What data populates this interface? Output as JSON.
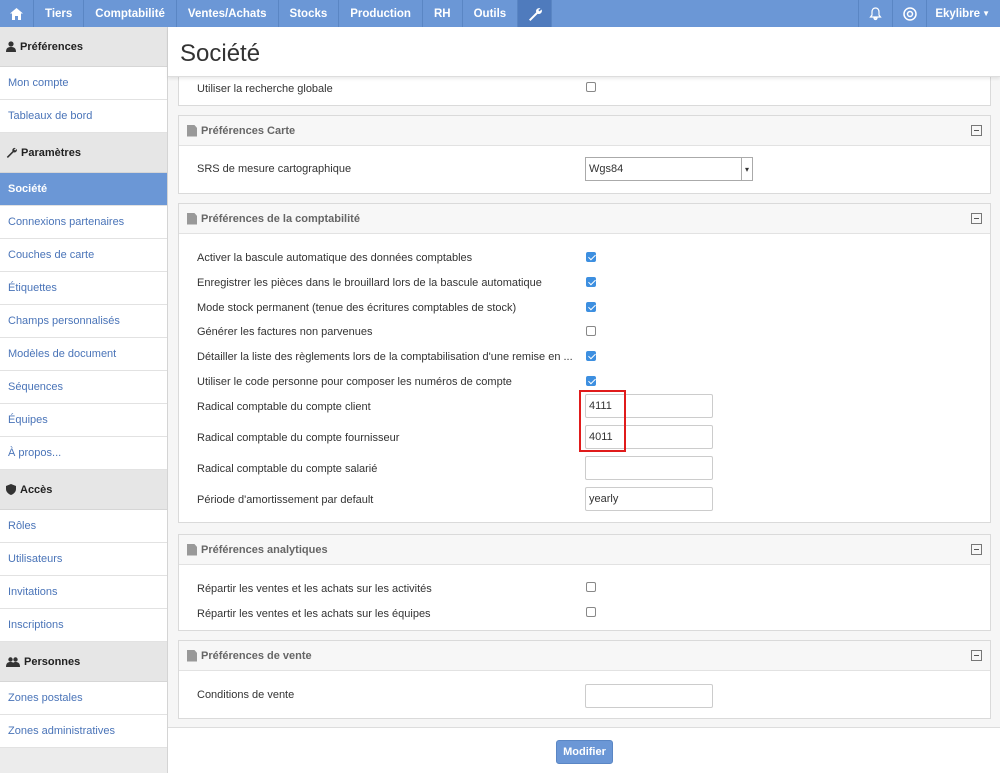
{
  "topnav": {
    "items": [
      "Tiers",
      "Comptabilité",
      "Ventes/Achats",
      "Stocks",
      "Production",
      "RH",
      "Outils"
    ],
    "user_label": "Ekylibre",
    "icons": [
      "home-icon",
      "wrench-icon",
      "bell-icon",
      "lifebuoy-icon"
    ]
  },
  "sidebar": {
    "sections": [
      {
        "title": "Préférences",
        "icon": "user-icon",
        "items": [
          "Mon compte",
          "Tableaux de bord"
        ]
      },
      {
        "title": "Paramètres",
        "icon": "wrench-icon",
        "items": [
          "Société",
          "Connexions partenaires",
          "Couches de carte",
          "Étiquettes",
          "Champs personnalisés",
          "Modèles de document",
          "Séquences",
          "Équipes",
          "À propos..."
        ]
      },
      {
        "title": "Accès",
        "icon": "shield-icon",
        "items": [
          "Rôles",
          "Utilisateurs",
          "Invitations",
          "Inscriptions"
        ]
      },
      {
        "title": "Personnes",
        "icon": "people-icon",
        "items": [
          "Zones postales",
          "Zones administratives"
        ]
      }
    ],
    "active_item": "Société"
  },
  "page": {
    "title": "Société"
  },
  "panels": {
    "general": {
      "rows": [
        {
          "label": "Utiliser la recherche globale",
          "checked": false
        }
      ]
    },
    "carte": {
      "title": "Préférences Carte",
      "srs_label": "SRS de mesure cartographique",
      "srs_value": "Wgs84"
    },
    "compta": {
      "title": "Préférences de la comptabilité",
      "checkboxes": [
        {
          "label": "Activer la bascule automatique des données comptables",
          "checked": true
        },
        {
          "label": "Enregistrer les pièces dans le brouillard lors de la bascule automatique",
          "checked": true
        },
        {
          "label": "Mode stock permanent (tenue des écritures comptables de stock)",
          "checked": true
        },
        {
          "label": "Générer les factures non parvenues",
          "checked": false
        },
        {
          "label": "Détailler la liste des règlements lors de la comptabilisation d'une remise en ...",
          "checked": true
        },
        {
          "label": "Utiliser le code personne pour composer les numéros de compte",
          "checked": true
        }
      ],
      "fields": [
        {
          "label": "Radical comptable du compte client",
          "value": "4111"
        },
        {
          "label": "Radical comptable du compte fournisseur",
          "value": "4011"
        },
        {
          "label": "Radical comptable du compte salarié",
          "value": ""
        },
        {
          "label": "Période d'amortissement par default",
          "value": "yearly"
        }
      ]
    },
    "analytiques": {
      "title": "Préférences analytiques",
      "checkboxes": [
        {
          "label": "Répartir les ventes et les achats sur les activités",
          "checked": false
        },
        {
          "label": "Répartir les ventes et les achats sur les équipes",
          "checked": false
        }
      ]
    },
    "vente": {
      "title": "Préférences de vente",
      "field_label": "Conditions de vente",
      "field_value": ""
    }
  },
  "actions": {
    "submit_label": "Modifier"
  },
  "colors": {
    "accent": "#6b97d6",
    "highlight": "#e01b1b",
    "checkbox": "#3d8fe0"
  }
}
